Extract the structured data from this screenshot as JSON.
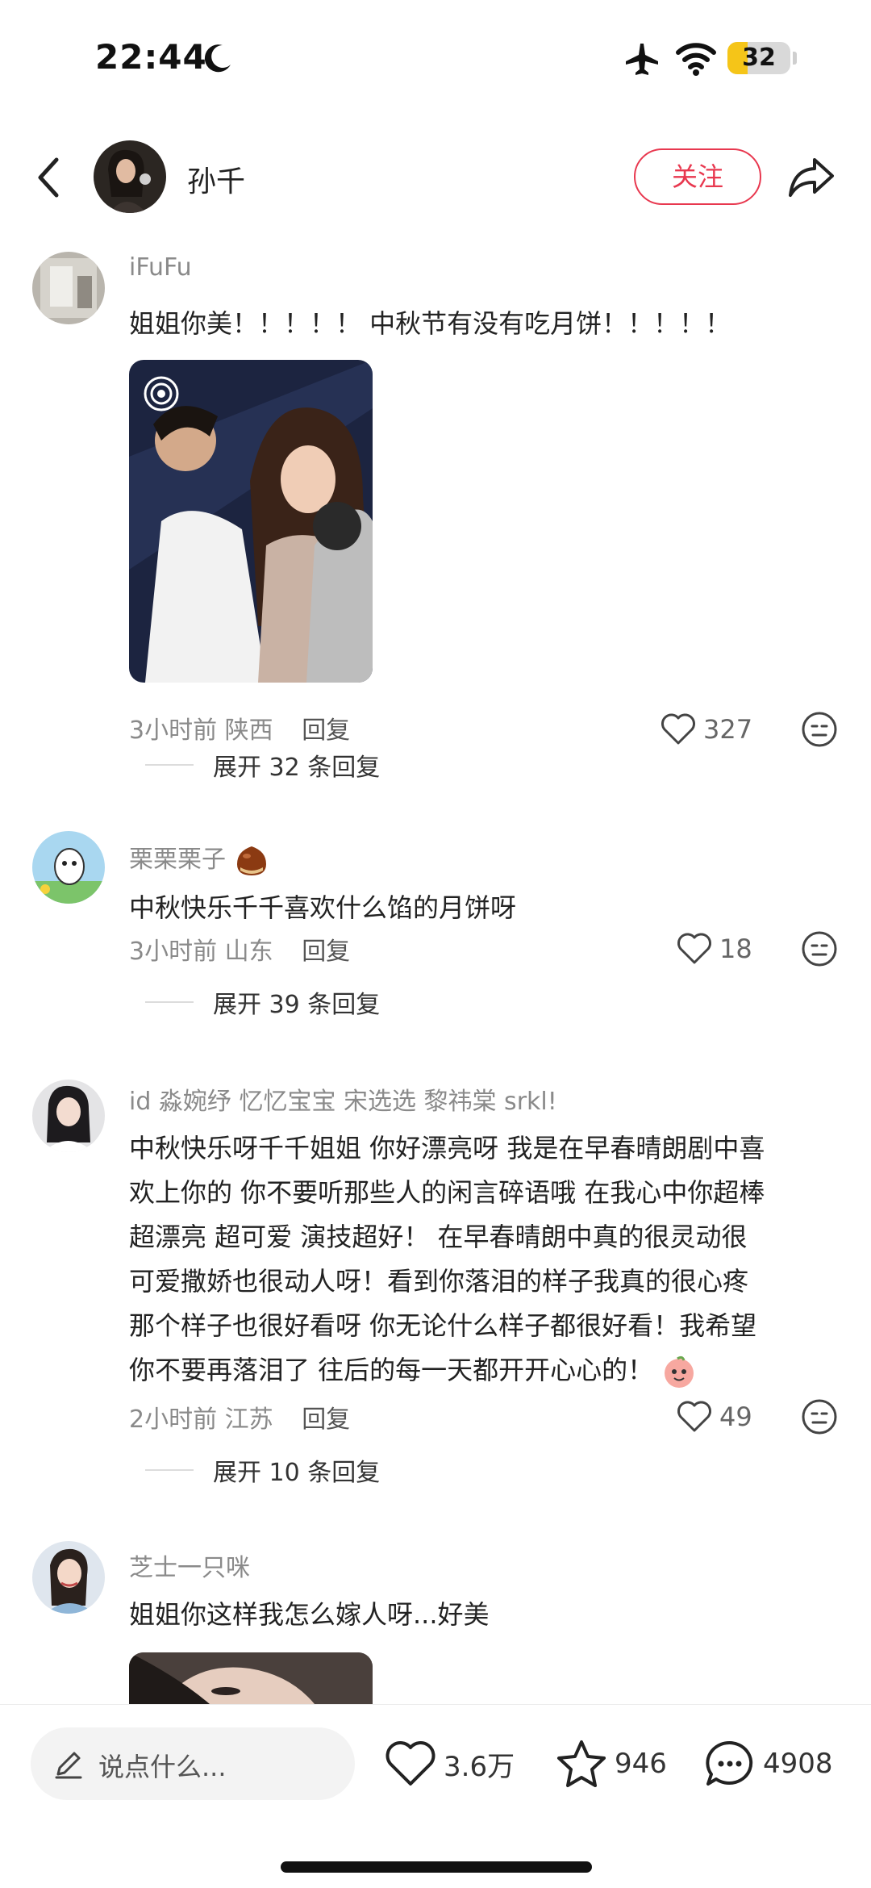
{
  "status_bar": {
    "time": "22:44",
    "battery": "32",
    "battery_level": 0.32
  },
  "header": {
    "name": "孙千",
    "follow_label": "关注"
  },
  "comments": [
    {
      "user": "iFuFu",
      "text": "姐姐你美！！！！！ 中秋节有没有吃月饼！！！！！",
      "time": "3小时前",
      "location": "陕西",
      "reply_label": "回复",
      "likes": "327",
      "expand": "展开 32 条回复"
    },
    {
      "user": "栗栗栗子",
      "text": "中秋快乐千千喜欢什么馅的月饼呀",
      "time": "3小时前",
      "location": "山东",
      "reply_label": "回复",
      "likes": "18",
      "expand": "展开 39 条回复"
    },
    {
      "user": "id 淼婉纾 忆忆宝宝 宋选选 黎祎棠 srkl!",
      "lines": [
        "中秋快乐呀千千姐姐  你好漂亮呀  我是在早春晴朗剧中喜",
        "欢上你的  你不要听那些人的闲言碎语哦  在我心中你超棒",
        "超漂亮  超可爱  演技超好！   在早春晴朗中真的很灵动很",
        "可爱撒娇也很动人呀！看到你落泪的样子我真的很心疼",
        "那个样子也很好看呀  你无论什么样子都很好看！我希望",
        "你不要再落泪了  往后的每一天都开开心心的！"
      ],
      "time": "2小时前",
      "location": "江苏",
      "reply_label": "回复",
      "likes": "49",
      "expand": "展开 10 条回复"
    },
    {
      "user": "芝士一只咪",
      "text": "姐姐你这样我怎么嫁人呀...好美"
    }
  ],
  "bottom": {
    "placeholder": "说点什么...",
    "likes": "3.6万",
    "favorites": "946",
    "comments": "4908"
  }
}
